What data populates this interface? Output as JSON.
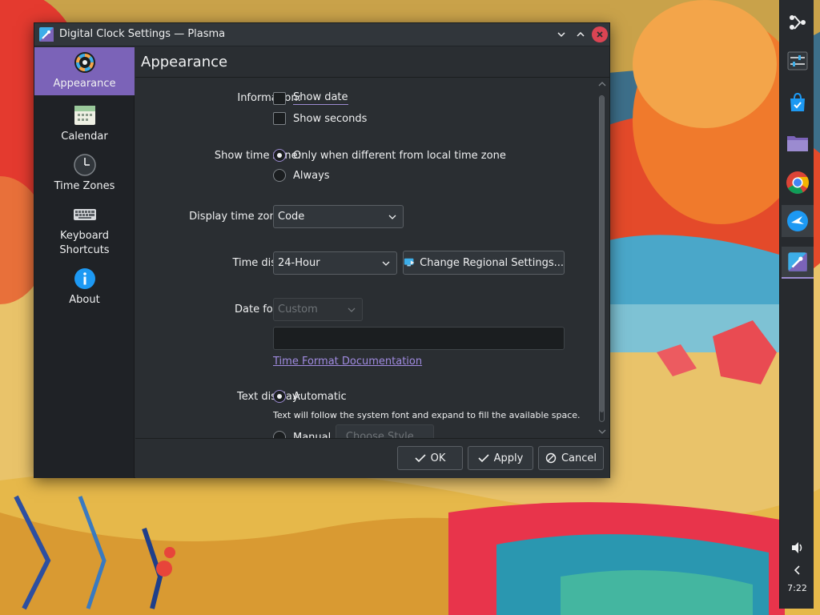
{
  "window": {
    "title": "Digital Clock Settings — Plasma"
  },
  "sidebar": {
    "items": [
      {
        "label": "Appearance",
        "icon": "color-wheel-icon",
        "active": true
      },
      {
        "label": "Calendar",
        "icon": "calendar-icon"
      },
      {
        "label": "Time Zones",
        "icon": "clock-icon"
      },
      {
        "label": "Keyboard Shortcuts",
        "icon": "keyboard-icon"
      },
      {
        "label": "About",
        "icon": "info-icon"
      }
    ]
  },
  "page": {
    "title": "Appearance"
  },
  "form": {
    "information": {
      "label": "Information:",
      "show_date": "Show date",
      "show_date_checked": false,
      "show_seconds": "Show seconds",
      "show_seconds_checked": false
    },
    "time_zone": {
      "label": "Show time zone:",
      "option_different": "Only when different from local time zone",
      "option_always": "Always",
      "selected": "option_different"
    },
    "display_tz_as": {
      "label": "Display time zone as:",
      "value": "Code"
    },
    "time_display": {
      "label": "Time display:",
      "value": "24-Hour",
      "regional_button": "Change Regional Settings..."
    },
    "date_format": {
      "label": "Date format:",
      "value": "Custom",
      "custom_field_value": "",
      "doc_link": "Time Format Documentation"
    },
    "text_display": {
      "label": "Text display:",
      "automatic": "Automatic",
      "automatic_hint": "Text will follow the system font and expand to fill the available space.",
      "manual": "Manual",
      "choose_style": "Choose Style...",
      "selected": "automatic"
    }
  },
  "footer": {
    "ok": "OK",
    "apply": "Apply",
    "cancel": "Cancel"
  },
  "panel": {
    "clock": "7:22"
  },
  "colors": {
    "accent": "#7b63b8",
    "window_bg": "#2a2e32",
    "sidebar_bg": "#1f2226",
    "close_button": "#da4453",
    "link": "#a08be0"
  }
}
